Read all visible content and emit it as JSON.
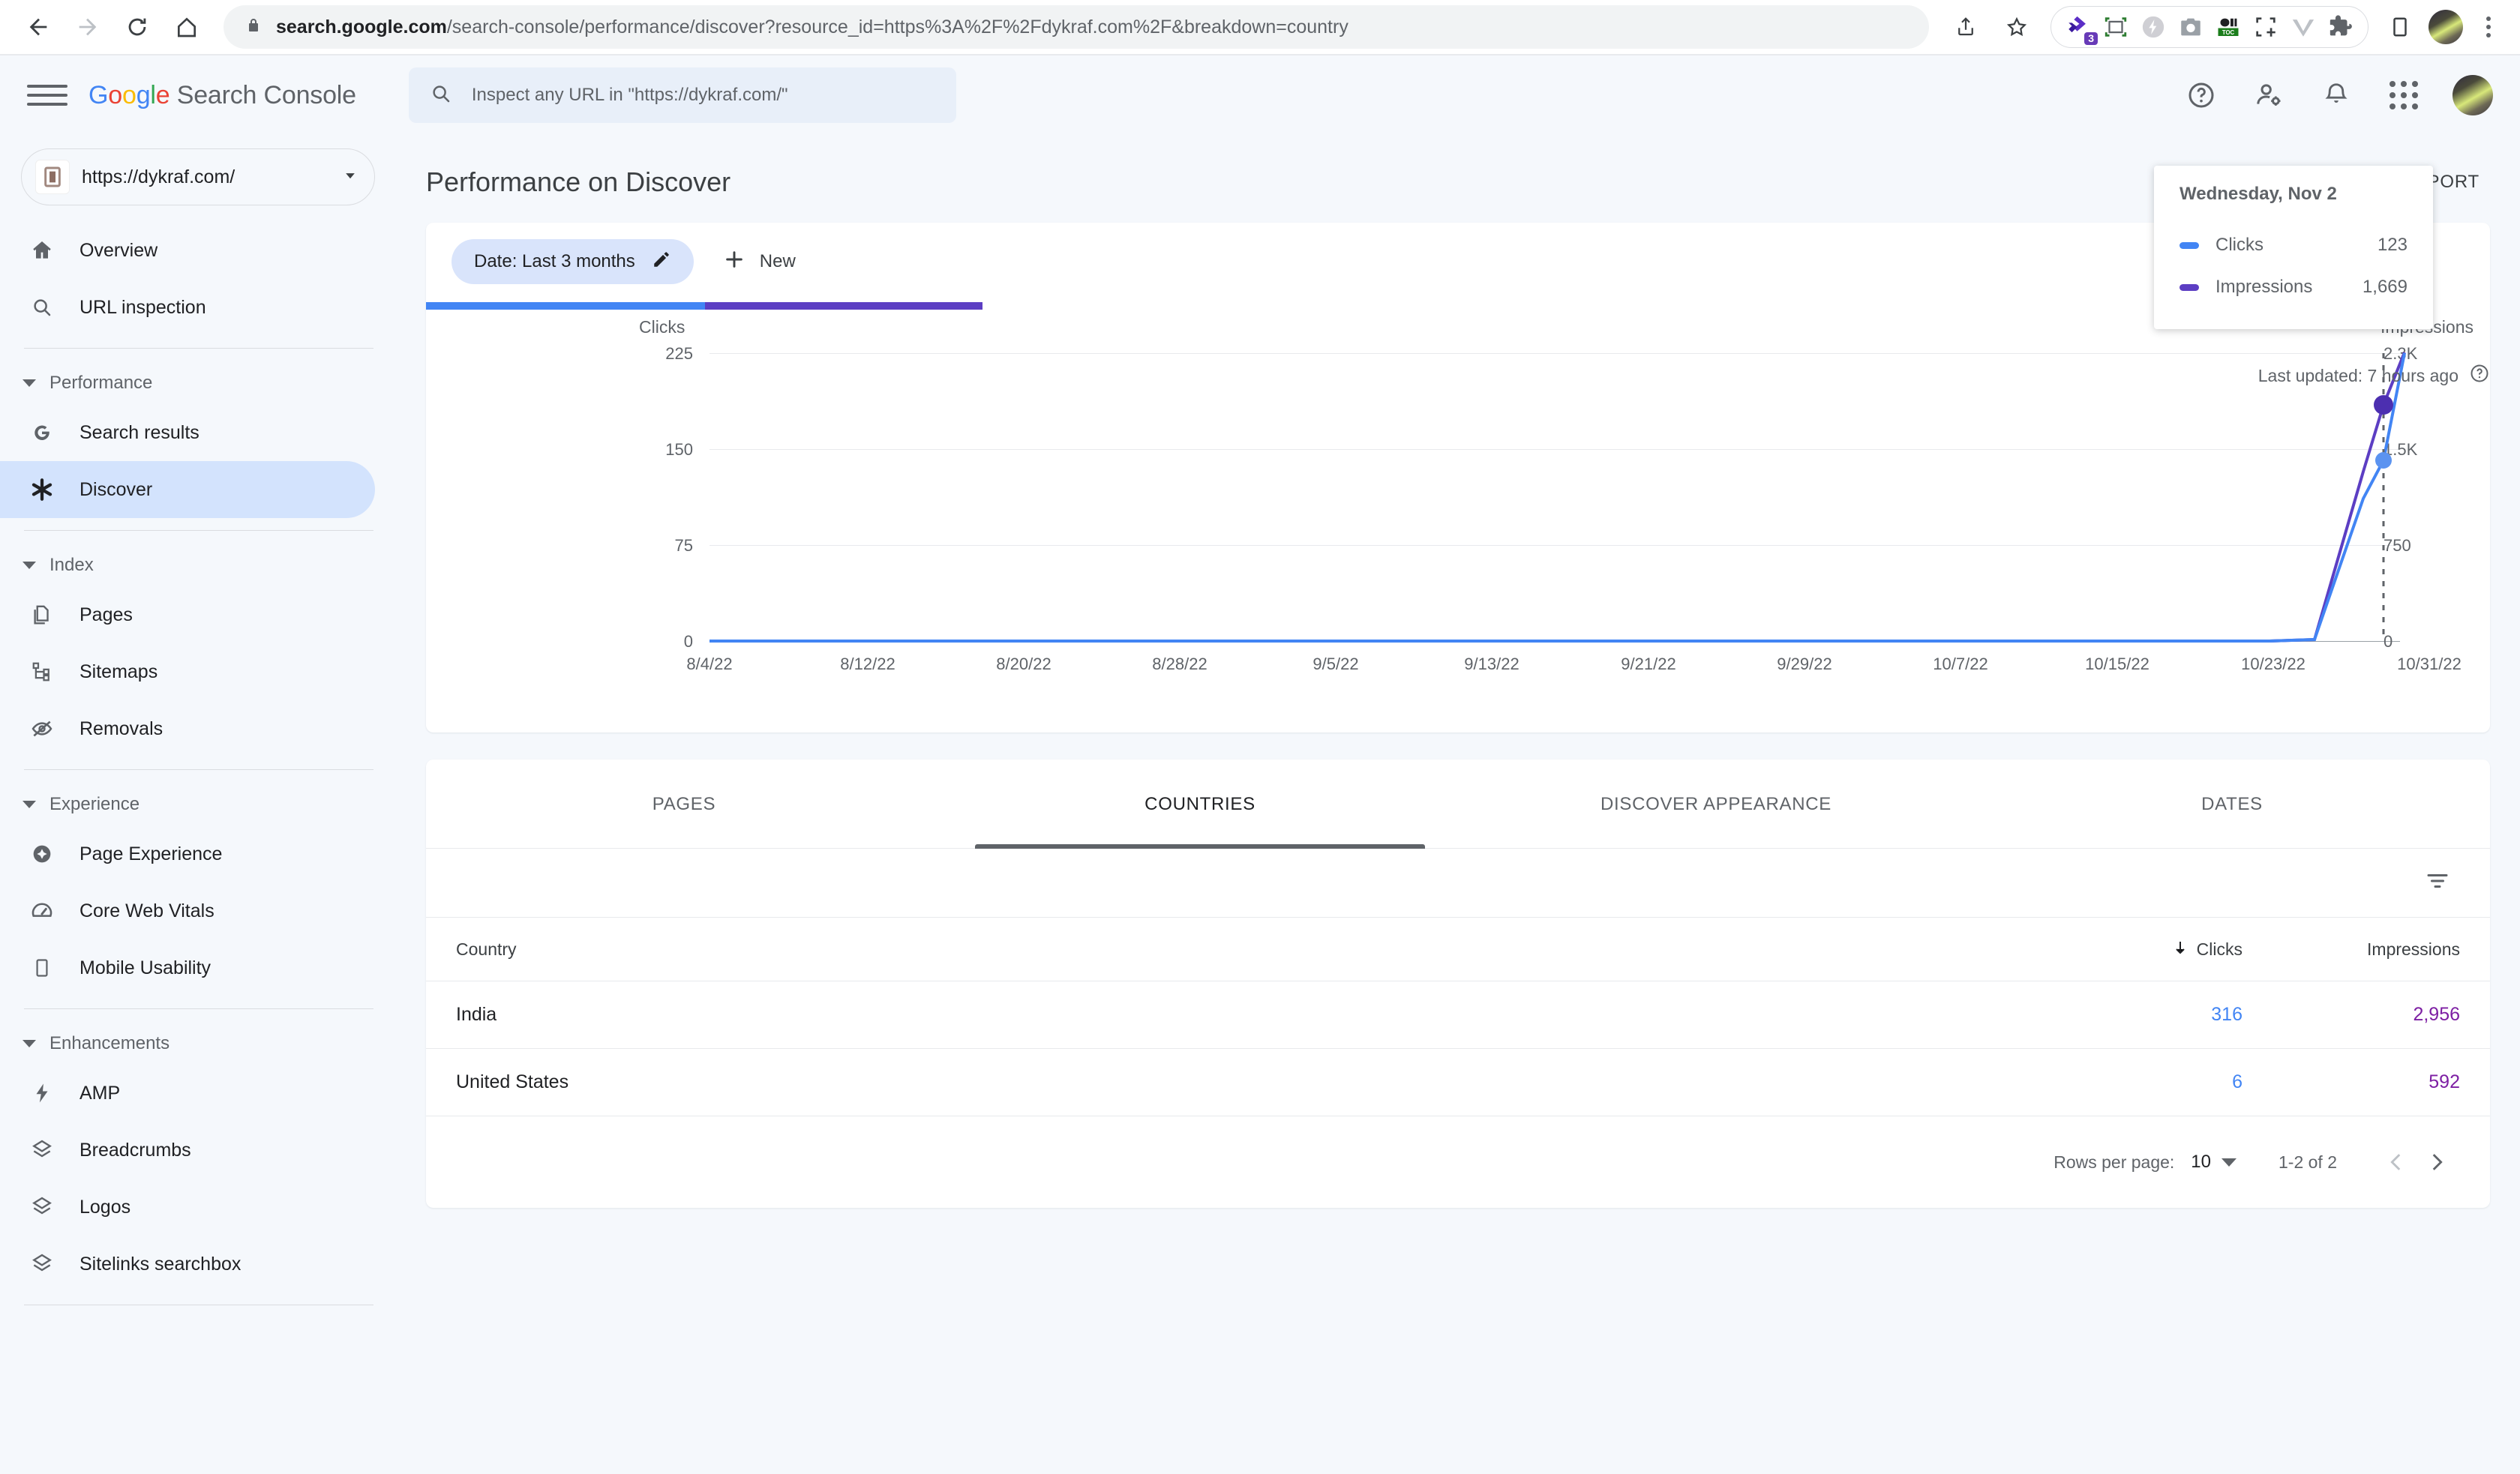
{
  "browser": {
    "url_domain": "search.google.com",
    "url_path": "/search-console/performance/discover?resource_id=https%3A%2F%2Fdykraf.com%2F&breakdown=country",
    "extension_badge": "3",
    "toc_label": "TOC"
  },
  "header": {
    "brand_google": "Google",
    "brand_product": "Search Console",
    "inspect_placeholder": "Inspect any URL in \"https://dykraf.com/\""
  },
  "sidebar": {
    "property": "https://dykraf.com/",
    "top_items": [
      {
        "label": "Overview",
        "icon": "home-icon"
      },
      {
        "label": "URL inspection",
        "icon": "search-icon"
      }
    ],
    "groups": [
      {
        "title": "Performance",
        "items": [
          {
            "label": "Search results",
            "icon": "google-g-icon"
          },
          {
            "label": "Discover",
            "icon": "asterisk-icon",
            "active": true
          }
        ]
      },
      {
        "title": "Index",
        "items": [
          {
            "label": "Pages",
            "icon": "pages-icon"
          },
          {
            "label": "Sitemaps",
            "icon": "sitemap-icon"
          },
          {
            "label": "Removals",
            "icon": "eye-off-icon"
          }
        ]
      },
      {
        "title": "Experience",
        "items": [
          {
            "label": "Page Experience",
            "icon": "page-experience-icon"
          },
          {
            "label": "Core Web Vitals",
            "icon": "speedometer-icon"
          },
          {
            "label": "Mobile Usability",
            "icon": "mobile-icon"
          }
        ]
      },
      {
        "title": "Enhancements",
        "items": [
          {
            "label": "AMP",
            "icon": "bolt-icon"
          },
          {
            "label": "Breadcrumbs",
            "icon": "layers-icon"
          },
          {
            "label": "Logos",
            "icon": "layers-icon"
          },
          {
            "label": "Sitelinks searchbox",
            "icon": "layers-icon"
          }
        ]
      }
    ]
  },
  "main": {
    "page_title": "Performance on Discover",
    "export_label": "EXPORT",
    "date_chip": "Date: Last 3 months",
    "new_filter_label": "New",
    "last_updated": "Last updated: 7 hours ago"
  },
  "tooltip": {
    "date": "Wednesday, Nov 2",
    "rows": [
      {
        "label": "Clicks",
        "value": "123",
        "color": "#4285f4"
      },
      {
        "label": "Impressions",
        "value": "1,669",
        "color": "#5c3ec3"
      }
    ]
  },
  "table": {
    "tabs": [
      {
        "label": "PAGES",
        "active": false
      },
      {
        "label": "COUNTRIES",
        "active": true
      },
      {
        "label": "DISCOVER APPEARANCE",
        "active": false
      },
      {
        "label": "DATES",
        "active": false
      }
    ],
    "columns": [
      "Country",
      "Clicks",
      "Impressions"
    ],
    "sorted_column": "Clicks",
    "rows": [
      {
        "country": "India",
        "clicks": "316",
        "impressions": "2,956"
      },
      {
        "country": "United States",
        "clicks": "6",
        "impressions": "592"
      }
    ],
    "pager": {
      "rows_per_page_label": "Rows per page:",
      "rows_per_page_value": "10",
      "range": "1-2 of 2"
    }
  },
  "chart_data": {
    "type": "line",
    "title": "",
    "ylabel": "Clicks",
    "y2label": "Impressions",
    "xlabel": "",
    "ylim": [
      0,
      225
    ],
    "y2lim": [
      0,
      2300
    ],
    "yticks": [
      "0",
      "75",
      "150",
      "225"
    ],
    "y2ticks": [
      "0",
      "750",
      "1.5K",
      "2.3K"
    ],
    "grid": true,
    "legend": "none",
    "xticks": [
      "8/4/22",
      "8/12/22",
      "8/20/22",
      "8/28/22",
      "9/5/22",
      "9/13/22",
      "9/21/22",
      "9/29/22",
      "10/7/22",
      "10/15/22",
      "10/23/22",
      "10/31/22"
    ],
    "x_range": [
      "8/4/22",
      "11/2/22"
    ],
    "series": [
      {
        "name": "Clicks",
        "color": "#4285f4",
        "axis": "left",
        "highlight_value": 123,
        "highlight_date": "Wednesday, Nov 2",
        "note": "Flat near 0 for the entire range, then a sharp rise at the far right end of the period",
        "points": [
          {
            "x": "8/4/22",
            "y": 0
          },
          {
            "x": "9/1/22",
            "y": 0
          },
          {
            "x": "10/1/22",
            "y": 0
          },
          {
            "x": "10/28/22",
            "y": 0
          },
          {
            "x": "10/30/22",
            "y": 1
          },
          {
            "x": "11/1/22",
            "y": 108
          },
          {
            "x": "11/2/22",
            "y": 123
          },
          {
            "x": "11/3/22",
            "y": 196
          }
        ]
      },
      {
        "name": "Impressions",
        "color": "#5c3ec3",
        "axis": "right",
        "highlight_value": 1669,
        "highlight_date": "Wednesday, Nov 2",
        "note": "Flat near 0 for the entire range, then a sharp rise at the far right end of the period",
        "points": [
          {
            "x": "8/4/22",
            "y": 0
          },
          {
            "x": "9/1/22",
            "y": 0
          },
          {
            "x": "10/1/22",
            "y": 0
          },
          {
            "x": "10/28/22",
            "y": 0
          },
          {
            "x": "10/30/22",
            "y": 10
          },
          {
            "x": "11/1/22",
            "y": 1180
          },
          {
            "x": "11/2/22",
            "y": 1669
          },
          {
            "x": "11/3/22",
            "y": 2030
          }
        ]
      }
    ]
  }
}
